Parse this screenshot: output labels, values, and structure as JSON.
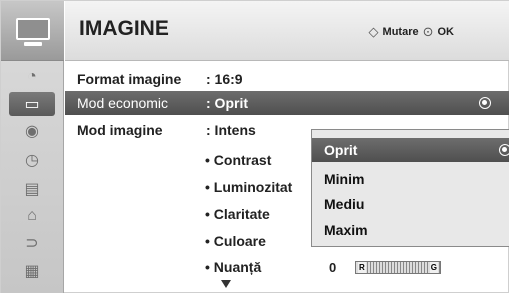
{
  "header": {
    "title": "IMAGINE",
    "move_hint": "Mutare",
    "ok_hint": "OK"
  },
  "sidebar": {
    "items": [
      {
        "icon": "satellite-dish-icon",
        "glyph": "◔"
      },
      {
        "icon": "tv-picture-icon",
        "glyph": "▭"
      },
      {
        "icon": "speaker-audio-icon",
        "glyph": "◉"
      },
      {
        "icon": "clock-time-icon",
        "glyph": "◷"
      },
      {
        "icon": "calendar-option-icon",
        "glyph": "▤"
      },
      {
        "icon": "lock-icon",
        "glyph": "⌂"
      },
      {
        "icon": "input-plug-icon",
        "glyph": "⊃"
      },
      {
        "icon": "clapperboard-icon",
        "glyph": "▦"
      }
    ]
  },
  "settings": [
    {
      "label": "Format imagine",
      "value": ": 16:9"
    },
    {
      "label": "Mod economic",
      "value": ": Oprit"
    },
    {
      "label": "Mod imagine",
      "value": ": Intens"
    }
  ],
  "sub_items": [
    {
      "label": "• Contrast",
      "value": ""
    },
    {
      "label": "• Luminozitat",
      "value": ""
    },
    {
      "label": "• Claritate",
      "value": ""
    },
    {
      "label": "• Culoare",
      "value": ""
    },
    {
      "label": "• Nuanță",
      "value": "0"
    }
  ],
  "tint_bar": {
    "left_label": "R",
    "right_label": "G"
  },
  "dropdown": {
    "options": [
      "Oprit",
      "Minim",
      "Mediu",
      "Maxim"
    ],
    "selected": "Oprit"
  },
  "colors": {
    "highlight": "#5e5e5e",
    "rail": "#cfcfcf",
    "background": "#ffffff"
  }
}
